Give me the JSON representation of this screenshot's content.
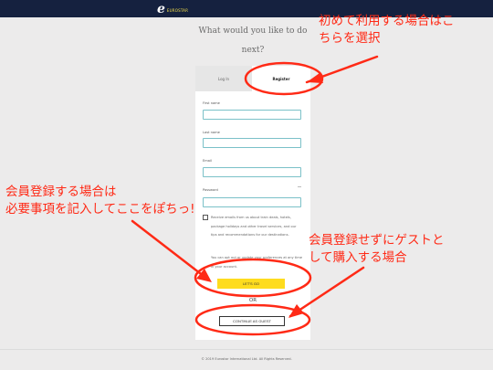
{
  "header": {
    "logo_letter": "e",
    "logo_text": "EUROSTAR"
  },
  "page": {
    "heading_line1": "What would you like to do",
    "heading_line2": "next?"
  },
  "tabs": {
    "login": "Log In",
    "register": "Register"
  },
  "form": {
    "first_name": "First name",
    "last_name": "Last name",
    "email": "Email",
    "password": "Password",
    "consent_text": "Receive emails from us about train deals, hotels, package holidays and other travel services, and our tips and recommendations for our destinations.",
    "optout_text": "You can opt out or update your preferences at any time in your account."
  },
  "buttons": {
    "lets_go": "LET'S GO",
    "or": "OR",
    "continue_guest": "CONTINUE AS GUEST"
  },
  "footer": {
    "copyright": "© 2019 Eurostar International Ltd. All Rights Reserved."
  },
  "annotations": {
    "top_right_line1": "初めて利用する場合はこ",
    "top_right_line2": "ちらを選択",
    "left_line1": "会員登録する場合は",
    "left_line2": "必要事項を記入してここをぽちっ!",
    "right_line1": "会員登録せずにゲストと",
    "right_line2": "して購入する場合"
  },
  "colors": {
    "header_bg": "#15213f",
    "accent_yellow": "#fedc1e",
    "field_border": "#7bc1c8",
    "annotation_red": "#ff2a16",
    "background": "#ecebeb"
  }
}
